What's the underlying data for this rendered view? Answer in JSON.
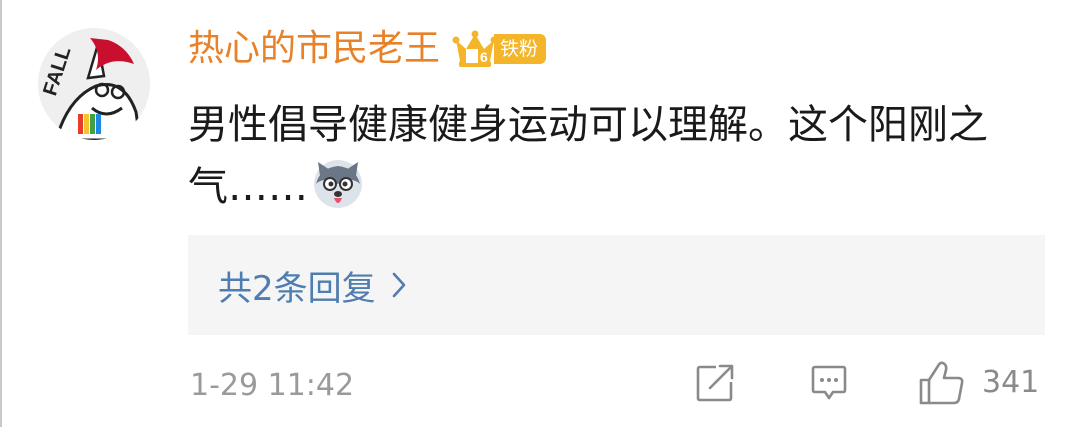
{
  "comment": {
    "username": "热心的市民老王",
    "badge": {
      "level": "6",
      "label": "铁粉",
      "color": "#f4b52b",
      "icon": "crown-icon"
    },
    "text": "男性倡导健康健身运动可以理解。这个阳刚之气……",
    "emoji": "husky-dog-emoji",
    "replies_label": "共2条回复",
    "timestamp": "1-29 11:42",
    "like_count": "341"
  },
  "actions": {
    "repost_icon": "repost-icon",
    "reply_icon": "reply-icon",
    "like_icon": "thumbs-up-icon"
  },
  "colors": {
    "username": "#e8822a",
    "link": "#507daf",
    "meta": "#9a9a9a",
    "text": "#1a1a1a",
    "reply_box_bg": "#f5f5f5"
  }
}
